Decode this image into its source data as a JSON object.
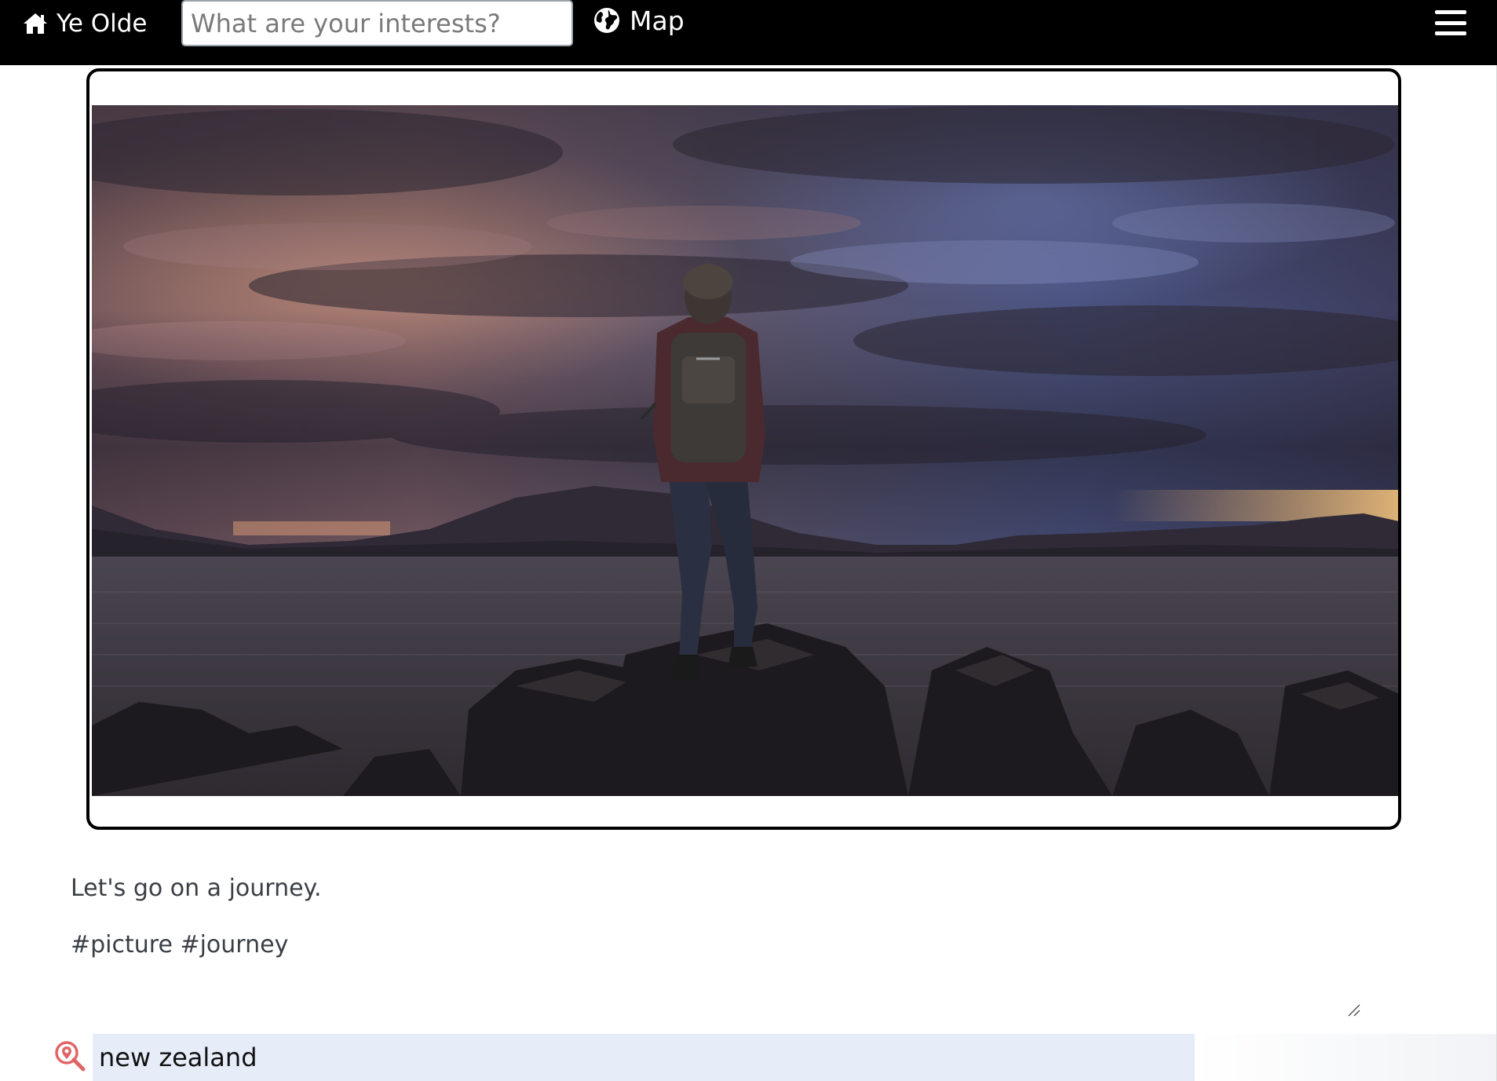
{
  "navbar": {
    "home_label": "Ye Olde",
    "search_placeholder": "What are your interests?",
    "map_label": "Map",
    "home_icon": "home-icon",
    "map_icon": "globe-icon",
    "menu_icon": "hamburger-menu-icon"
  },
  "post": {
    "image_icon": "landscape-photo",
    "caption": "Let's go on a journey.",
    "tags": "#picture #journey"
  },
  "location_search": {
    "icon": "location-search-icon",
    "value": "new zealand"
  },
  "colors": {
    "navbar_bg": "#000000",
    "card_border": "#000000",
    "text": "#3a3f45",
    "location_input_bg": "#e6edf9",
    "location_icon": "#e06666"
  }
}
